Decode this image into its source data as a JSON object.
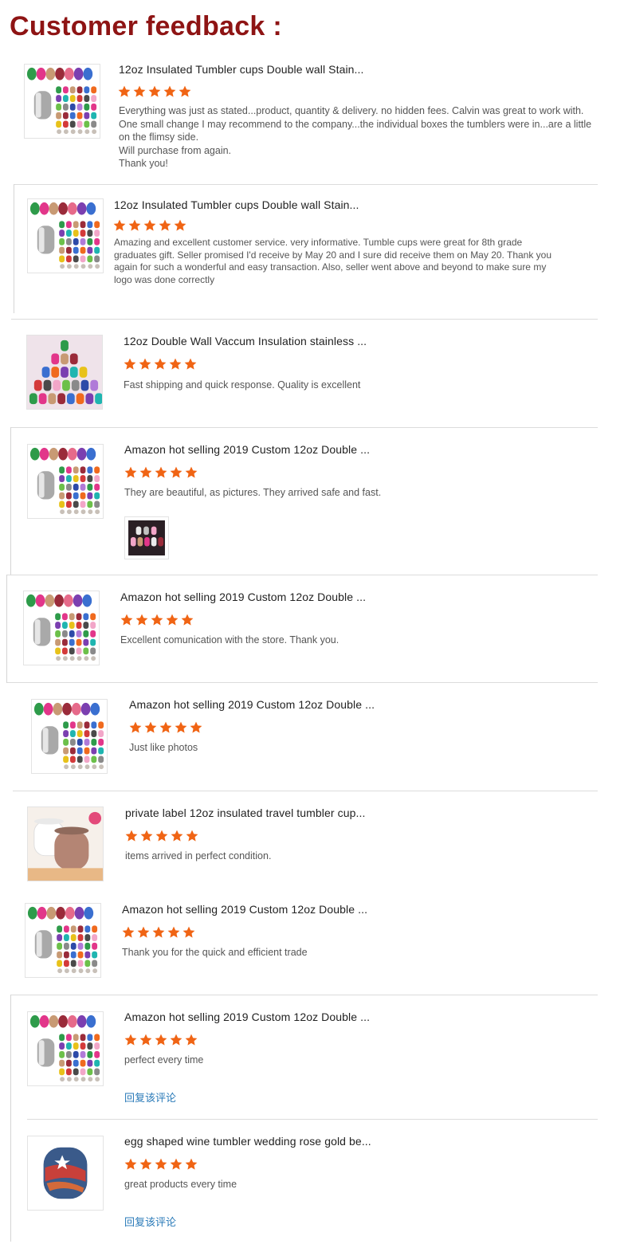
{
  "page": {
    "title": "Customer feedback :"
  },
  "star_color": "#f06414",
  "link_color": "#2a7ab8",
  "reviews": [
    {
      "title": "12oz Insulated Tumbler cups Double wall Stain...",
      "rating": 5,
      "text": "Everything was just as stated...product, quantity & delivery. no hidden fees. Calvin was great to work with. One small change I may recommend to the company...the individual boxes the tumblers were in...are a little on the flimsy side.\nWill purchase from again.\nThank you!"
    },
    {
      "title": "12oz Insulated Tumbler cups Double wall Stain...",
      "rating": 5,
      "text": "Amazing and excellent customer service. very informative. Tumble cups were great for 8th grade graduates gift. Seller promised I'd receive by May 20 and I sure did receive them on May 20. Thank you again for such a wonderful and easy transaction. Also, seller went above and beyond to make sure my logo was done correctly"
    },
    {
      "title": "12oz Double Wall Vaccum Insulation stainless ...",
      "rating": 5,
      "text": "Fast shipping and quick response.  Quality is excellent"
    },
    {
      "title": "Amazon hot selling 2019 Custom 12oz Double ...",
      "rating": 5,
      "text": "They are beautiful, as pictures. They arrived safe and fast."
    },
    {
      "title": "Amazon hot selling 2019 Custom 12oz Double ...",
      "rating": 5,
      "text": "Excellent comunication with the store. Thank you."
    },
    {
      "title": "Amazon hot selling 2019 Custom 12oz Double ...",
      "rating": 5,
      "text": "Just like photos"
    },
    {
      "title": "private label 12oz insulated travel tumbler cup...",
      "rating": 5,
      "text": "items arrived in perfect condition."
    },
    {
      "title": "Amazon hot selling 2019 Custom 12oz Double ...",
      "rating": 5,
      "text": "Thank you for the quick and efficient trade"
    },
    {
      "title": "Amazon hot selling 2019 Custom 12oz Double ...",
      "rating": 5,
      "text": "perfect every time",
      "reply_label": "回复该评论"
    },
    {
      "title": "egg shaped wine tumbler wedding rose gold be...",
      "rating": 5,
      "text": "great products every time",
      "reply_label": "回复该评论"
    }
  ]
}
